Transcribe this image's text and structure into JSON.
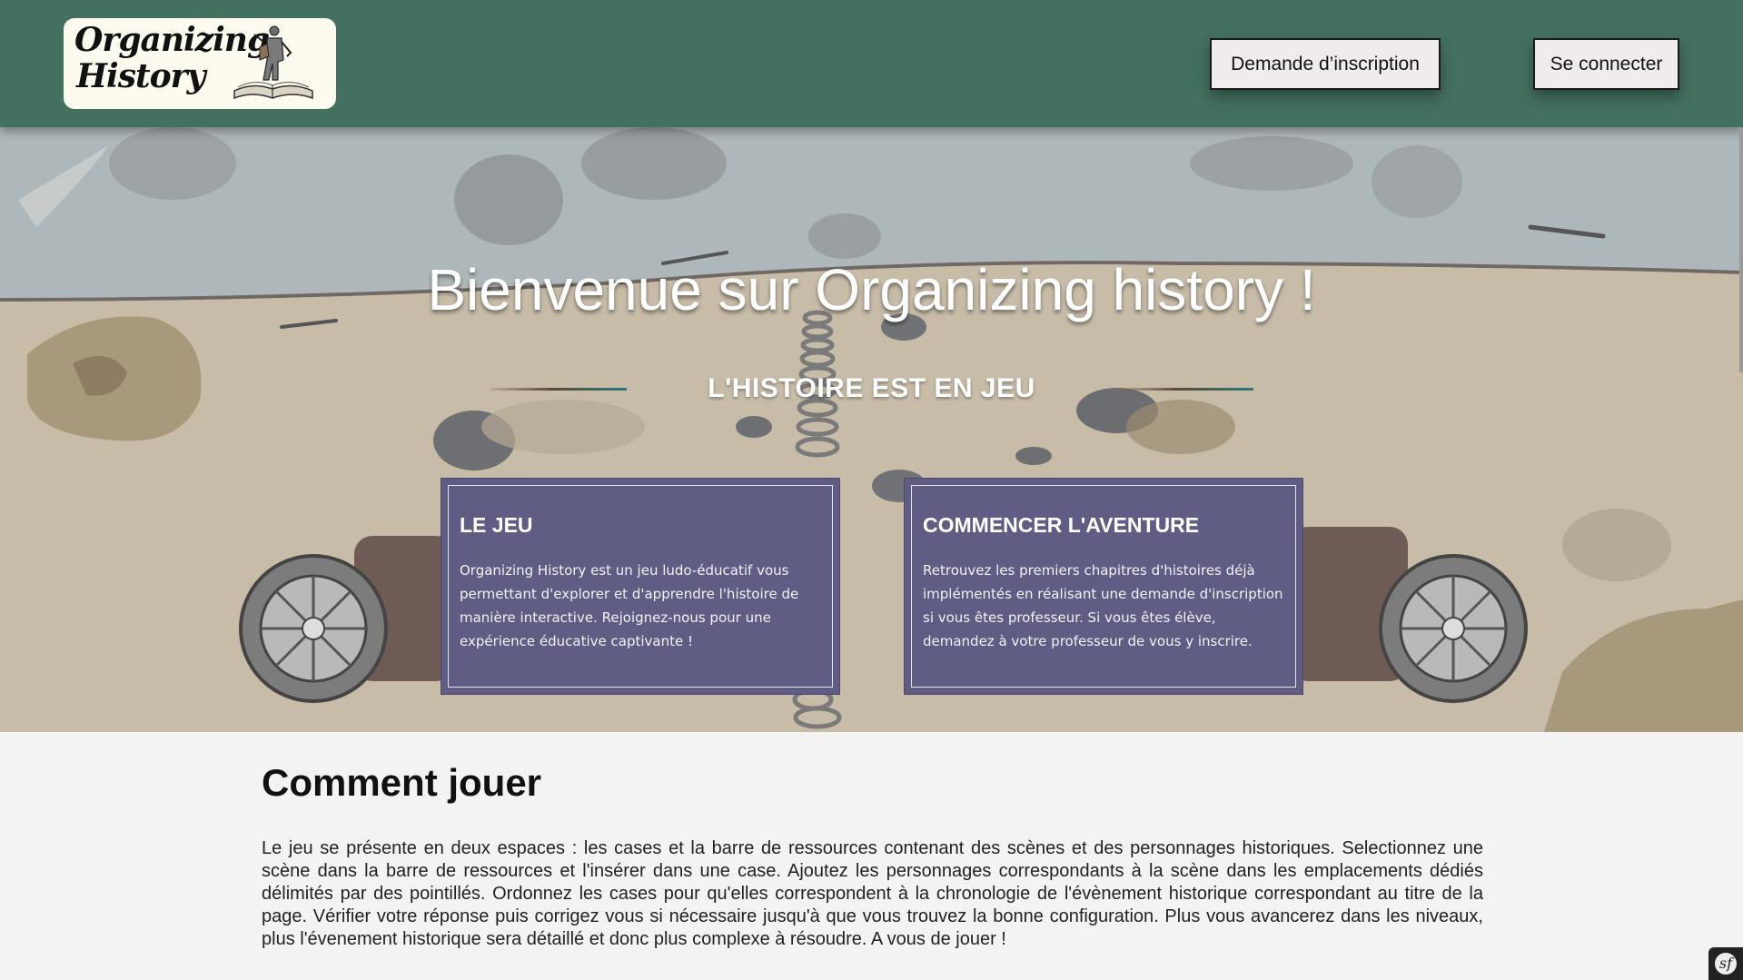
{
  "header": {
    "logo_line1": "Organizing",
    "logo_line2": "History",
    "register_label": "Demande d’inscription",
    "login_label": "Se connecter"
  },
  "hero": {
    "title": "Bienvenue sur Organizing history !",
    "subtitle": "L'HISTOIRE EST EN JEU",
    "cards": [
      {
        "title": "LE JEU",
        "text": "Organizing History est un jeu ludo-éducatif vous permettant d'explorer et d'apprendre l'histoire de manière interactive. Rejoignez-nous pour une expérience éducative captivante !"
      },
      {
        "title": "COMMENCER L'AVENTURE",
        "text": "Retrouvez les premiers chapitres d'histoires déjà implémentés en réalisant une demande d'inscription si vous êtes professeur. Si vous êtes élève, demandez à votre professeur de vous y inscrire."
      }
    ]
  },
  "how_to_play": {
    "heading": "Comment jouer",
    "text": "Le jeu se présente en deux espaces : les cases et la barre de ressources contenant des scènes et des personnages historiques. Selectionnez une scène dans la barre de ressources et l'insérer dans une case. Ajoutez les personnages correspondants à la scène dans les emplacements dédiés délimités par des pointillés. Ordonnez les cases pour qu'elles correspondent à la chronologie de l'évènement historique correspondant au titre de la page. Vérifier votre réponse puis corrigez vous si nécessaire jusqu'à que vous trouvez la bonne configuration. Plus vous avancerez dans les niveaux, plus l'évenement historique sera détaillé et donc plus complexe à résoudre. A vous de jouer !"
  },
  "colors": {
    "header_bg": "#447060",
    "card_bg": "#5f5d84",
    "page_bg": "#f3f3f3"
  },
  "icons": {
    "logo": "knight-on-book-logo",
    "symfony": "symfony-toolbar-icon"
  }
}
